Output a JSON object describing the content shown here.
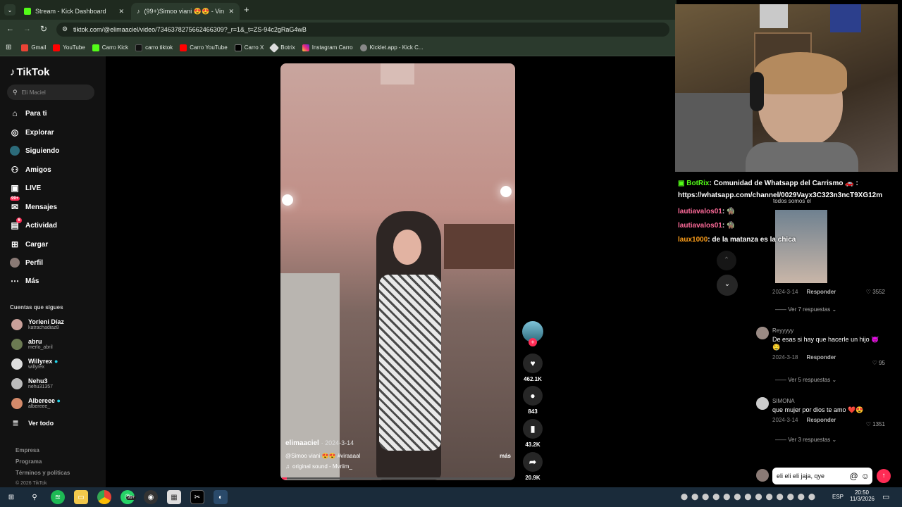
{
  "browser": {
    "tabs": [
      {
        "label": "Stream - Kick Dashboard"
      },
      {
        "label": "(99+)Simoo viani 😍😍 - Vira"
      }
    ],
    "url": "tiktok.com/@elimaaciel/video/7346378275662466309?_r=1&_t=ZS-94c2gRaG4wB",
    "bookmarks": [
      "Gmail",
      "YouTube",
      "Carro Kick",
      "carro tiktok",
      "Carro YouTube",
      "Carro X",
      "Botrix",
      "Instagram Carro",
      "Kicklet.app - Kick C..."
    ]
  },
  "tiktok": {
    "logo": "TikTok",
    "search_placeholder": "Eli Maciel",
    "nav": [
      "Para ti",
      "Explorar",
      "Siguiendo",
      "Amigos",
      "LIVE",
      "Mensajes",
      "Actividad",
      "Cargar",
      "Perfil",
      "Más"
    ],
    "messages_badge": "99+",
    "activity_badge": "6",
    "following_heading": "Cuentas que sigues",
    "following": [
      {
        "name": "Yorleni Díaz",
        "user": "katrachadiaz8"
      },
      {
        "name": "abru",
        "user": "merlo_abril"
      },
      {
        "name": "Willyrex",
        "user": "willyrex"
      },
      {
        "name": "Nehu3",
        "user": "nehu31357"
      },
      {
        "name": "Albereee",
        "user": "albereee_"
      }
    ],
    "see_all": "Ver todo",
    "footer": [
      "Empresa",
      "Programa",
      "Términos y políticas",
      "© 2026 TikTok"
    ]
  },
  "video": {
    "author": "elimaaciel",
    "date": "· 2024-3-14",
    "caption": "@Simoo viani 😍😍 #viraaaal",
    "more": "más",
    "sound": "original sound - Mvriim_",
    "progress": 0.02,
    "likes": "462.1K",
    "comments": "843",
    "saves": "43.2K",
    "shares": "20.9K"
  },
  "chat_overlay": [
    {
      "user": "BotRix",
      "text": ": Comunidad de Whatsapp del Carrismo 🚗 : https://whatsapp.com/channel/0029Vayx3C323n3ncT9XG12m",
      "color": "#53fc18"
    },
    {
      "user": "lautiavalos01",
      "text": ": 🧌",
      "color": "#ff6b9a"
    },
    {
      "user": "lautiavalos01",
      "text": ": 🧌",
      "color": "#ff6b9a"
    },
    {
      "user": "laux1000",
      "text": ": de la matanza es la chica",
      "color": "#ff9f1a"
    }
  ],
  "comments": {
    "partial_top": "todos somos el",
    "first": {
      "date": "2024-3-14",
      "reply": "Responder",
      "likes": "3552",
      "replies": "Ver 7 respuestas"
    },
    "list": [
      {
        "user": "Reyyyyy",
        "text": "De esas si hay que hacerle un hijo 😈🤤",
        "date": "2024-3-18",
        "reply": "Responder",
        "likes": "95",
        "replies": "Ver 5 respuestas"
      },
      {
        "user": "SIMONA",
        "text": "que mujer por dios te amo ❤️😍",
        "date": "2024-3-14",
        "reply": "Responder",
        "likes": "1351",
        "replies": "Ver 3 respuestas"
      }
    ],
    "input_value": "eli eli eli jaja, qye"
  },
  "taskbar": {
    "lang": "ESP",
    "time": "20:50",
    "date": "11/3/2026",
    "whatsapp_badge": "99+"
  }
}
